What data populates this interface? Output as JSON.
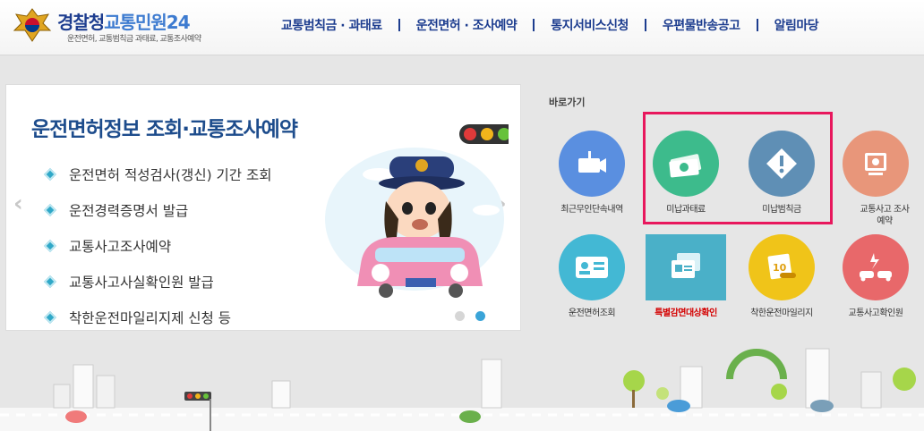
{
  "header": {
    "logo_title_main": "경찰청",
    "logo_title_sub": "교통민원24",
    "logo_subtitle": "운전면허, 교통범칙금 과태료, 교통조사예약",
    "nav": [
      {
        "label": "교통범칙금 · 과태료"
      },
      {
        "label": "운전면허 · 조사예약"
      },
      {
        "label": "통지서비스신청"
      },
      {
        "label": "우편물반송공고"
      },
      {
        "label": "알림마당"
      }
    ]
  },
  "banner": {
    "title": "운전면허정보 조회·교통조사예약",
    "items": [
      "운전면허 적성검사(갱신) 기간 조회",
      "운전경력증명서 발급",
      "교통사고조사예약",
      "교통사고사실확인원 발급",
      "착한운전마일리지제 신청 등"
    ],
    "prev_arrow": "‹",
    "next_arrow": "›"
  },
  "shortcuts": {
    "title": "바로가기",
    "items": [
      {
        "label": "최근무인단속내역",
        "color": "#5a8fe0",
        "icon": "camera-icon"
      },
      {
        "label": "미납과태료",
        "color": "#3dbb8c",
        "icon": "money-icon"
      },
      {
        "label": "미납범칙금",
        "color": "#5f8fb5",
        "icon": "warning-icon"
      },
      {
        "label": "교통사고 조사예약",
        "color": "#e8967a",
        "icon": "monitor-icon"
      },
      {
        "label": "운전면허조회",
        "color": "#43b8d4",
        "icon": "license-card-icon"
      },
      {
        "label": "특별감면대상확인",
        "color": "#4ab0c8",
        "icon": "documents-icon"
      },
      {
        "label": "착한운전마일리지",
        "color": "#f0c419",
        "icon": "mileage-card-icon"
      },
      {
        "label": "교통사고확인원",
        "color": "#e8686a",
        "icon": "car-crash-icon"
      }
    ]
  },
  "mileage_card_text": "10"
}
